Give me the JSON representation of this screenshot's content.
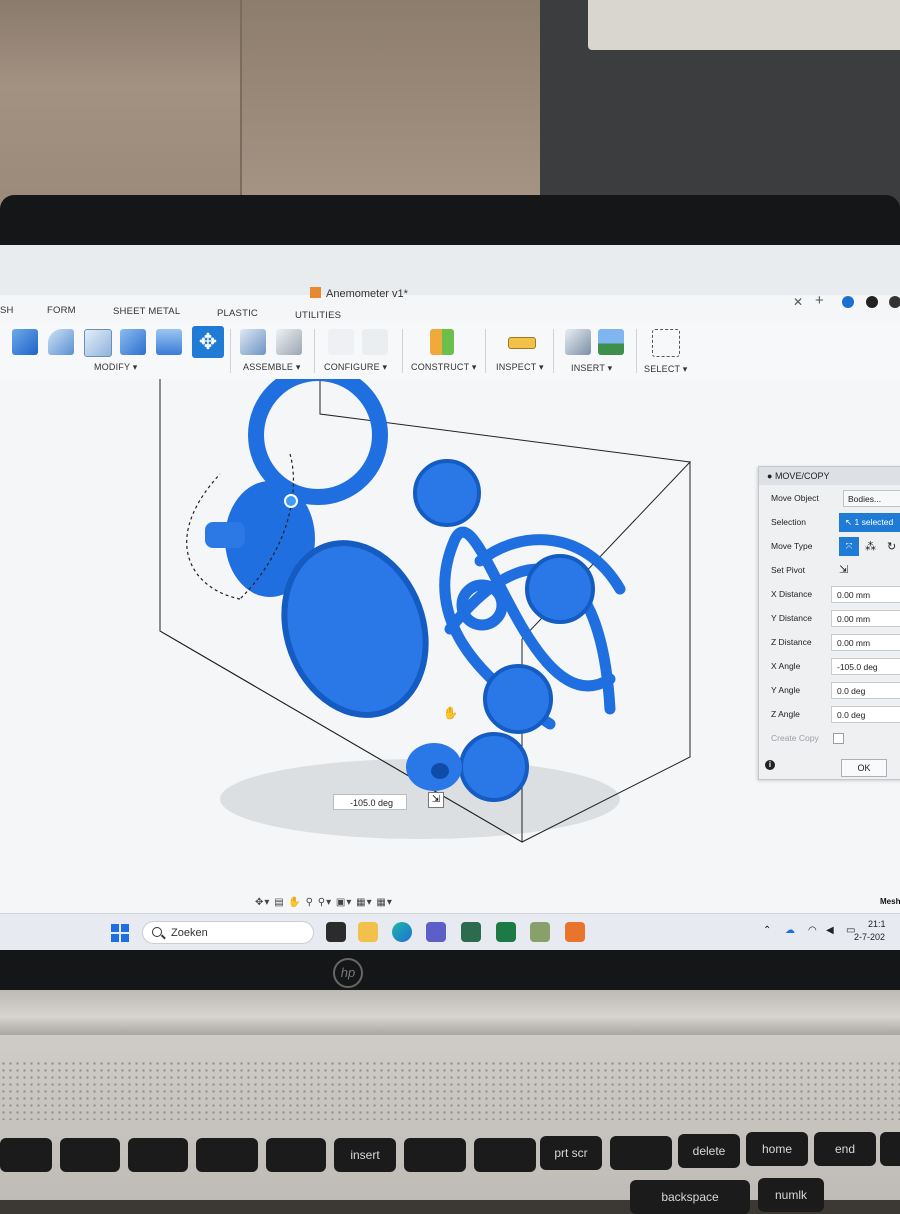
{
  "window": {
    "title": "Anemometer v1*",
    "close_glyph": "✕",
    "add_glyph": "+"
  },
  "tabs": [
    "SH",
    "FORM",
    "SHEET METAL",
    "PLASTIC",
    "UTILITIES"
  ],
  "toolbar_groups": {
    "modify": "MODIFY ▾",
    "assemble": "ASSEMBLE ▾",
    "configure": "CONFIGURE ▾",
    "construct": "CONSTRUCT ▾",
    "inspect": "INSPECT ▾",
    "insert": "INSERT ▾",
    "select": "SELECT ▾"
  },
  "viewport": {
    "angle_input": "-105.0 deg",
    "mesh_label": "Mesh"
  },
  "move_copy": {
    "title": "MOVE/COPY",
    "move_object_label": "Move Object",
    "move_object_value": "Bodies...",
    "selection_label": "Selection",
    "selection_value": "1 selected",
    "move_type_label": "Move Type",
    "set_pivot_label": "Set Pivot",
    "x_distance_label": "X Distance",
    "x_distance": "0.00 mm",
    "y_distance_label": "Y Distance",
    "y_distance": "0.00 mm",
    "z_distance_label": "Z Distance",
    "z_distance": "0.00 mm",
    "x_angle_label": "X Angle",
    "x_angle": "-105.0 deg",
    "y_angle_label": "Y Angle",
    "y_angle": "0.0 deg",
    "z_angle_label": "Z Angle",
    "z_angle": "0.0 deg",
    "create_copy_label": "Create Copy",
    "ok_label": "OK"
  },
  "taskbar": {
    "search_placeholder": "Zoeken",
    "time": "21:1",
    "date": "2-7-202"
  },
  "keyboard": {
    "keys": [
      "insert",
      "prt scr",
      "delete",
      "home",
      "end",
      "backspace",
      "numlk"
    ]
  },
  "colors": {
    "model_blue": "#1f6fe0",
    "accent_blue": "#1f7bd6"
  }
}
